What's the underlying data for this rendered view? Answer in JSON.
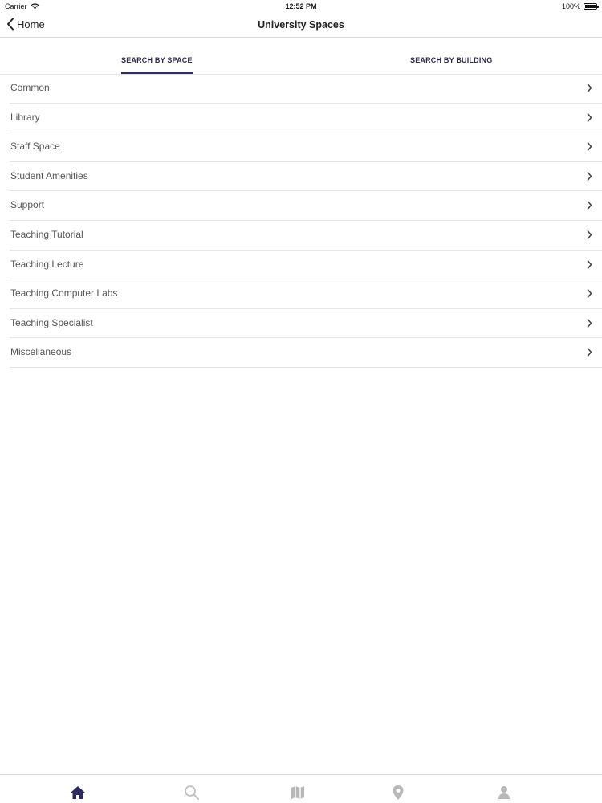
{
  "status_bar": {
    "carrier": "Carrier",
    "time": "12:52 PM",
    "battery": "100%"
  },
  "nav": {
    "back_label": "Home",
    "title": "University Spaces"
  },
  "tabs": [
    {
      "label": "SEARCH BY SPACE",
      "active": true
    },
    {
      "label": "SEARCH BY BUILDING",
      "active": false
    }
  ],
  "spaces": [
    {
      "label": "Common"
    },
    {
      "label": "Library"
    },
    {
      "label": "Staff Space"
    },
    {
      "label": "Student Amenities"
    },
    {
      "label": "Support"
    },
    {
      "label": "Teaching Tutorial"
    },
    {
      "label": "Teaching Lecture"
    },
    {
      "label": "Teaching Computer Labs"
    },
    {
      "label": "Teaching Specialist"
    },
    {
      "label": "Miscellaneous"
    }
  ],
  "tab_bar": {
    "items": [
      {
        "icon": "home-icon",
        "active": true
      },
      {
        "icon": "search-icon",
        "active": false
      },
      {
        "icon": "map-icon",
        "active": false
      },
      {
        "icon": "location-pin-icon",
        "active": false
      },
      {
        "icon": "profile-icon",
        "active": false
      }
    ]
  },
  "colors": {
    "accent": "#2c2a5e",
    "inactive_icon": "#b8b8b8",
    "divider": "#e6e6e6"
  }
}
